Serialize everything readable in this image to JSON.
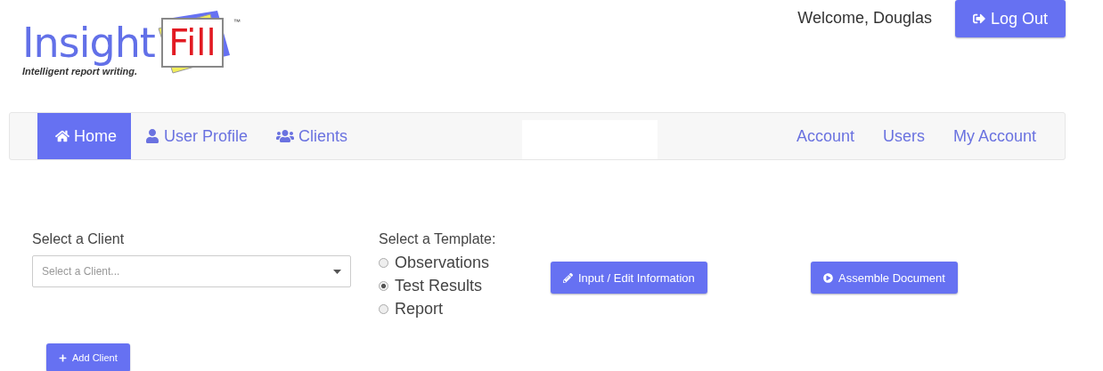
{
  "logo": {
    "word": "Insight",
    "badge": "Fill",
    "trademark": "™",
    "tagline": "Intelligent report writing."
  },
  "header": {
    "welcome": "Welcome, Douglas",
    "logout": "Log Out"
  },
  "nav": {
    "left": [
      {
        "label": "Home",
        "kind": "home",
        "selected": true
      },
      {
        "label": "User Profile",
        "kind": "user",
        "selected": false
      },
      {
        "label": "Clients",
        "kind": "users",
        "selected": false
      }
    ],
    "right": [
      {
        "label": "Account",
        "selected": false
      },
      {
        "label": "Users",
        "selected": false
      },
      {
        "label": "My Account",
        "selected": false
      }
    ]
  },
  "client": {
    "label": "Select a Client",
    "placeholder": "Select a Client..."
  },
  "template": {
    "label": "Select a Template:",
    "options": [
      {
        "label": "Observations",
        "selected": false
      },
      {
        "label": "Test Results",
        "selected": true
      },
      {
        "label": "Report",
        "selected": false
      }
    ]
  },
  "actions": [
    {
      "label": "Input / Edit Information",
      "kind": "pencil"
    },
    {
      "label": "Assemble Document",
      "kind": "play"
    }
  ],
  "add_client": {
    "label": "Add Client"
  }
}
